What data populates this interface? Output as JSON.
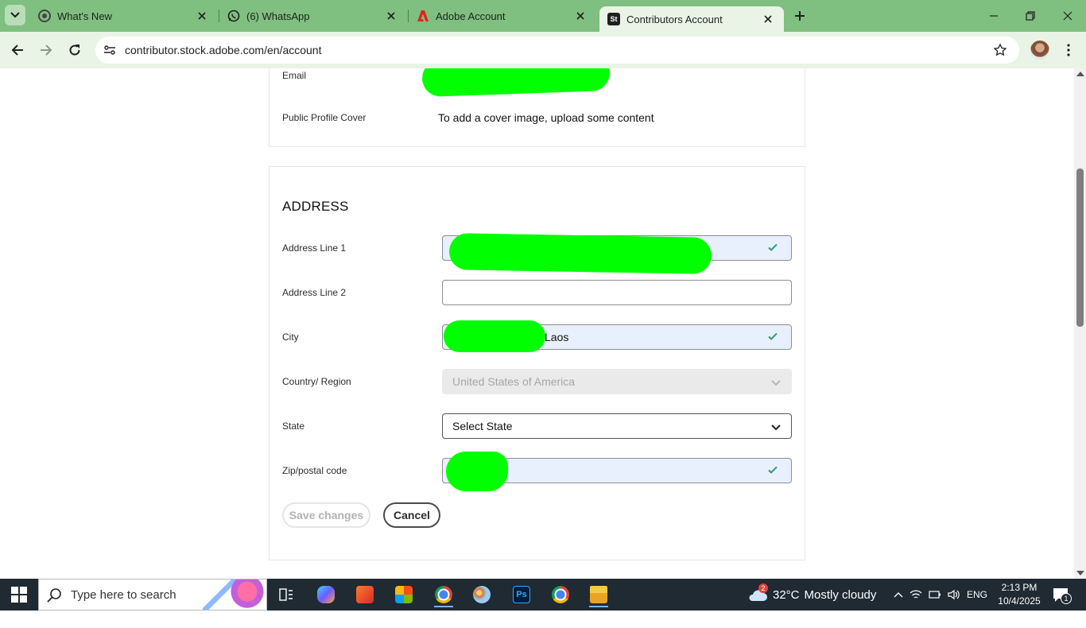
{
  "browser": {
    "tabs": [
      {
        "title": "What's New",
        "icon": "chrome-settings-icon",
        "active": false
      },
      {
        "title": "(6) WhatsApp",
        "icon": "whatsapp-icon",
        "active": false
      },
      {
        "title": "Adobe Account",
        "icon": "adobe-icon",
        "active": false
      },
      {
        "title": "Contributors Account",
        "icon": "adobe-stock-icon",
        "active": true
      }
    ],
    "url": "contributor.stock.adobe.com/en/account",
    "favicon_stock_text": "St"
  },
  "page": {
    "profile_section": {
      "email_label": "Email",
      "cover_label": "Public Profile Cover",
      "cover_value": "To add a cover image, upload some content"
    },
    "address_section": {
      "title": "ADDRESS",
      "line1": {
        "label": "Address Line 1",
        "value": ""
      },
      "line2": {
        "label": "Address Line 2",
        "value": ""
      },
      "city": {
        "label": "City",
        "value": "Laos"
      },
      "country": {
        "label": "Country/ Region",
        "value": "United States of America"
      },
      "state": {
        "label": "State",
        "value": "Select State"
      },
      "zip": {
        "label": "Zip/postal code",
        "value": ""
      },
      "save_label": "Save changes",
      "cancel_label": "Cancel"
    }
  },
  "taskbar": {
    "search_placeholder": "Type here to search",
    "weather_temp": "32°C",
    "weather_text": "Mostly cloudy",
    "weather_badge": "2",
    "language": "ENG",
    "time": "2:13 PM",
    "date": "10/4/2025",
    "notification_count": "1"
  },
  "colors": {
    "tab_strip": "#7fbf7f",
    "toolbar": "#e9f4e6",
    "redaction": "#00ff00",
    "autofill": "#e8f0fe",
    "check": "#2d9d78",
    "taskbar": "#1f2a33"
  }
}
